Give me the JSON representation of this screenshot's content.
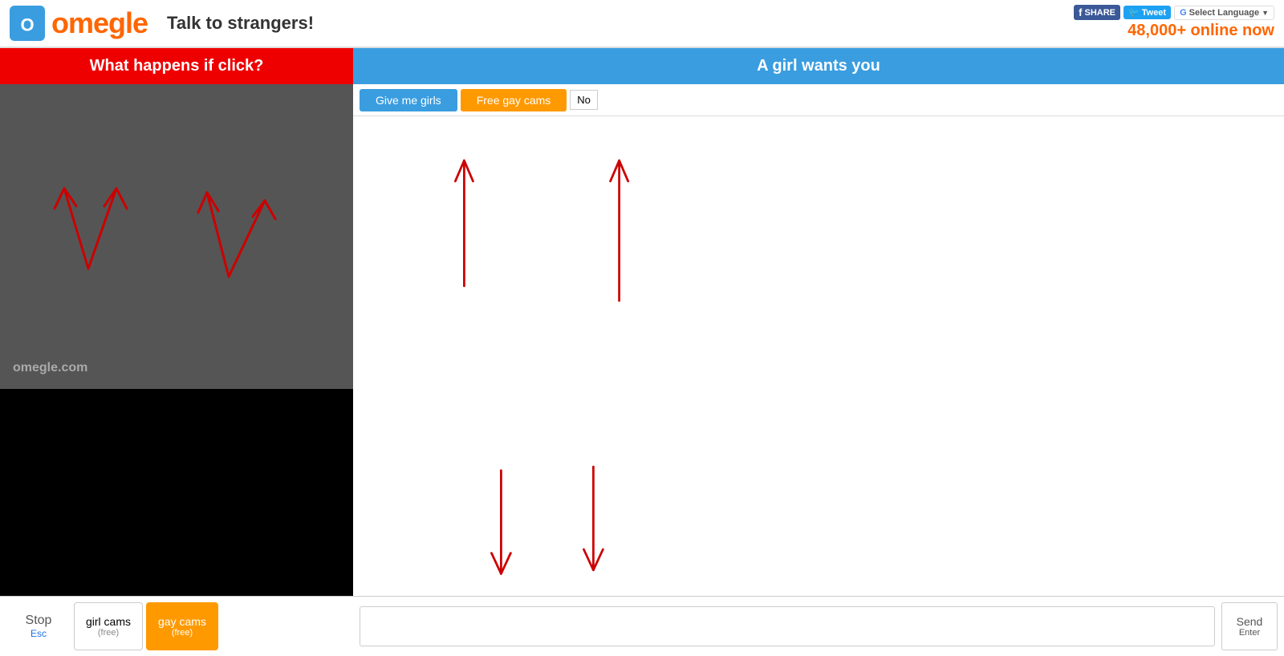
{
  "header": {
    "logo_text": "omegle",
    "tagline": "Talk to strangers!",
    "online_count": "48,000+",
    "online_label": " online now",
    "select_language": "Select Language",
    "fb_label": "SHARE",
    "tw_label": "Tweet"
  },
  "left": {
    "ad_banner": "What happens if click?",
    "watermark_main": "omegle",
    "watermark_sub": ".com"
  },
  "bottom_bar": {
    "stop_label": "Stop",
    "stop_sub": "Esc",
    "girl_cams_label": "girl cams",
    "girl_cams_sub": "(free)",
    "gay_cams_label": "gay cams",
    "gay_cams_sub": "(free)"
  },
  "chat": {
    "header": "A girl wants you",
    "give_girls": "Give me girls",
    "free_gay": "Free gay cams",
    "no_label": "No",
    "send_label": "Send",
    "send_sub": "Enter",
    "chat_placeholder": ""
  }
}
